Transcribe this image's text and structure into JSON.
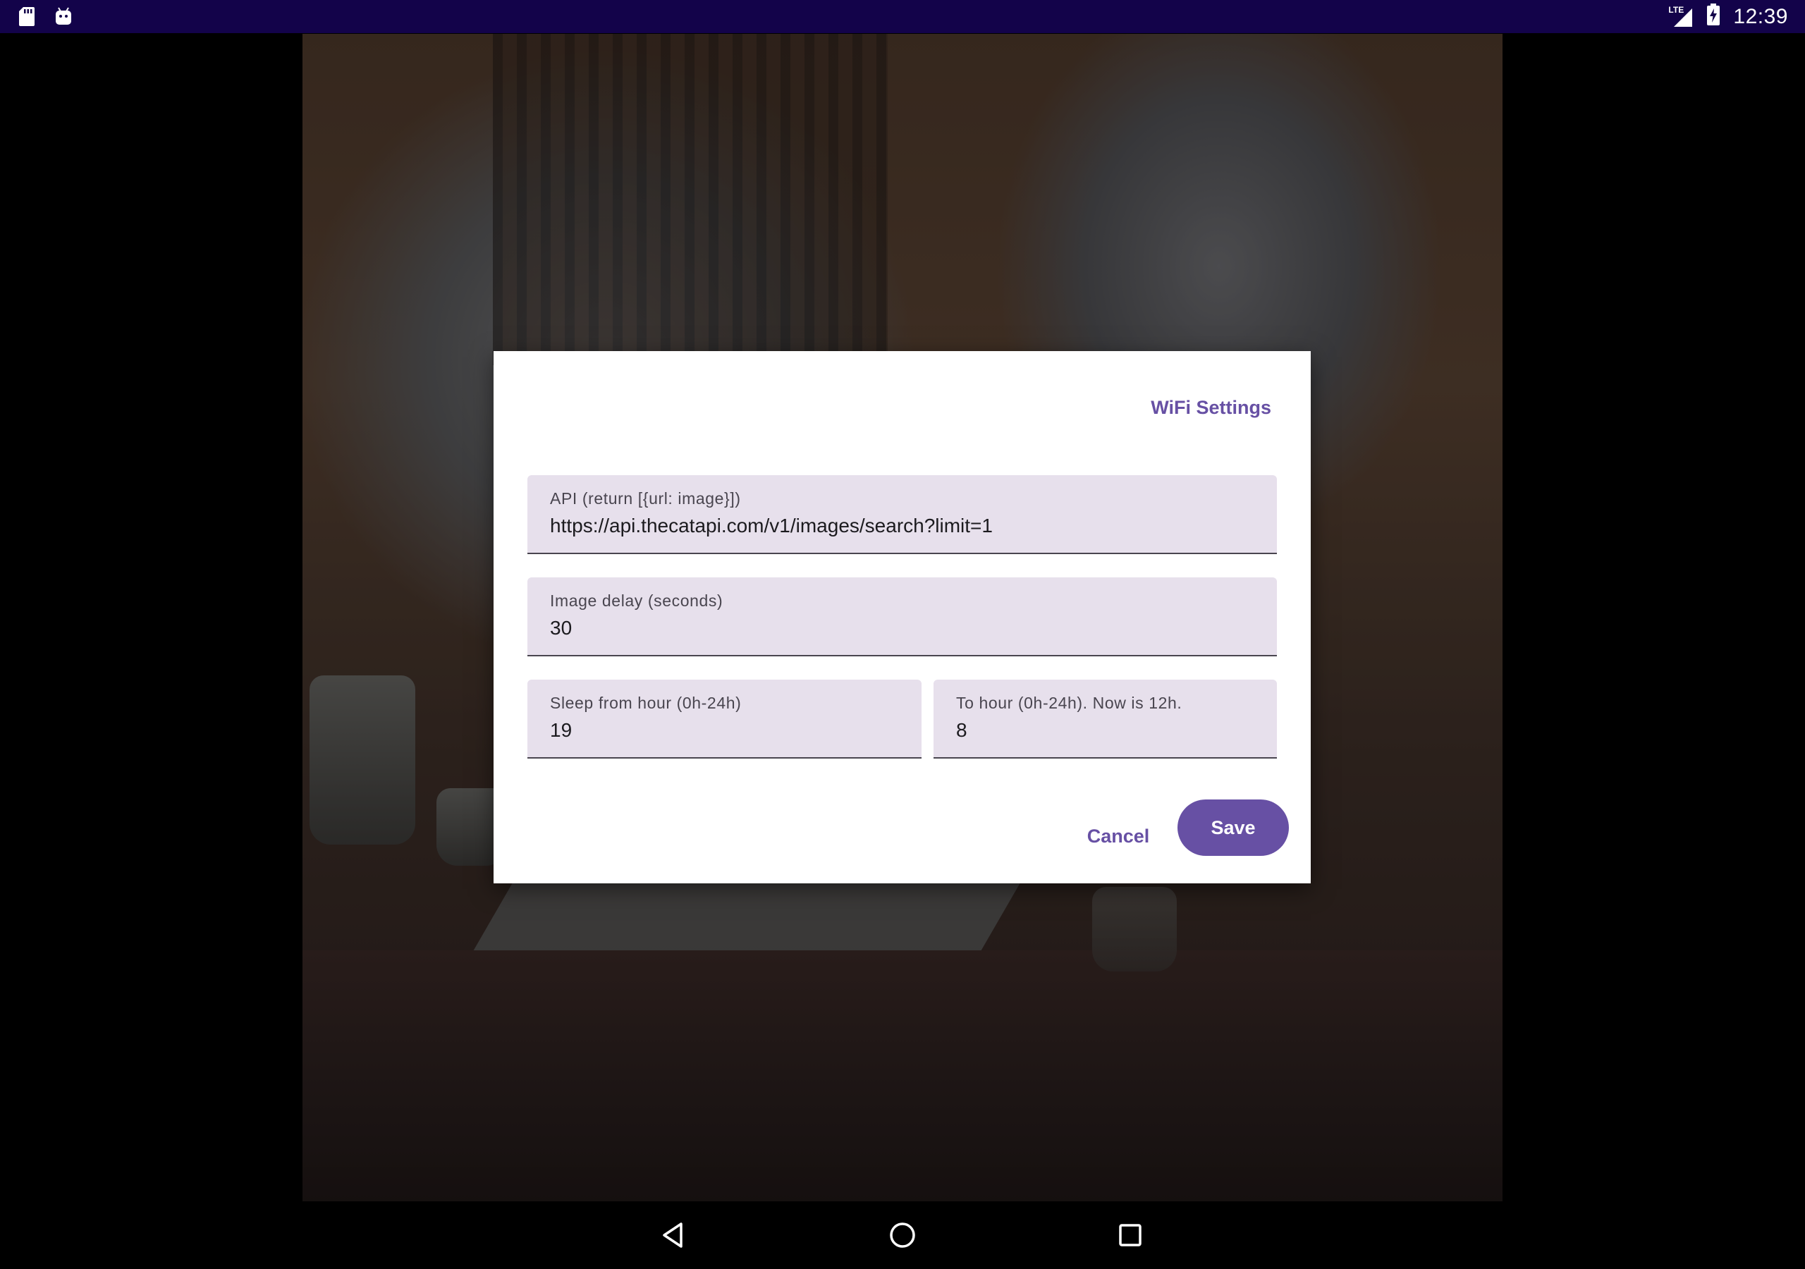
{
  "status_bar": {
    "left_icons": [
      "sd-card-icon",
      "android-icon"
    ],
    "right_icons": [
      "lte-signal-icon",
      "battery-charging-icon"
    ],
    "network_label": "LTE",
    "time": "12:39",
    "background_color": "#13034a"
  },
  "dialog": {
    "wifi_settings_label": "WiFi Settings",
    "fields": {
      "api": {
        "label": "API (return [{url: image}])",
        "value": "https://api.thecatapi.com/v1/images/search?limit=1"
      },
      "image_delay": {
        "label": "Image delay (seconds)",
        "value": "30"
      },
      "sleep_from": {
        "label": "Sleep from hour (0h-24h)",
        "value": "19"
      },
      "sleep_to": {
        "label": "To hour (0h-24h). Now is 12h.",
        "value": "8"
      }
    },
    "cancel_label": "Cancel",
    "save_label": "Save",
    "accent_color": "#6750a4",
    "field_background_color": "#e7e0ec"
  },
  "navigation_bar": {
    "icons": [
      "back-icon",
      "home-icon",
      "recents-icon"
    ]
  }
}
